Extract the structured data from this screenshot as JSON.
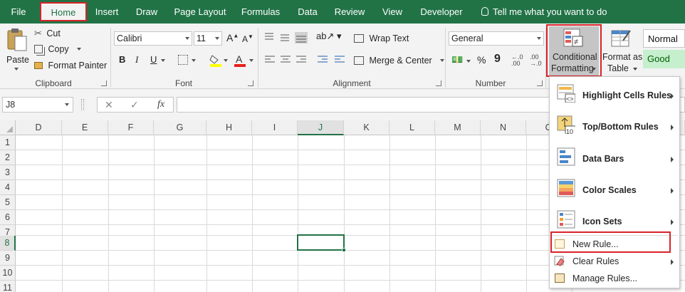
{
  "tabs": [
    "File",
    "Home",
    "Insert",
    "Draw",
    "Page Layout",
    "Formulas",
    "Data",
    "Review",
    "View",
    "Developer"
  ],
  "tell_me": "Tell me what you want to do",
  "clipboard": {
    "paste": "Paste",
    "cut": "Cut",
    "copy": "Copy",
    "format_painter": "Format Painter",
    "label": "Clipboard"
  },
  "font": {
    "name": "Calibri",
    "size": "11",
    "bold": "B",
    "italic": "I",
    "underline": "U",
    "label": "Font"
  },
  "alignment": {
    "wrap_text": "Wrap Text",
    "merge_center": "Merge & Center",
    "label": "Alignment"
  },
  "number": {
    "format": "General",
    "percent": "%",
    "comma": "9",
    "label": "Number"
  },
  "styles": {
    "conditional_formatting_line1": "Conditional",
    "conditional_formatting_line2": "Formatting",
    "format_as_table_line1": "Format as",
    "format_as_table_line2": "Table",
    "normal": "Normal",
    "good": "Good"
  },
  "formula_bar": {
    "name_box": "J8",
    "fx": "fx",
    "cancel": "✕",
    "enter": "✓"
  },
  "columns": [
    "D",
    "E",
    "F",
    "G",
    "H",
    "I",
    "J",
    "K",
    "L",
    "M",
    "N",
    "O"
  ],
  "rows": [
    "1",
    "2",
    "3",
    "4",
    "5",
    "6",
    "7",
    "8",
    "9",
    "10",
    "11"
  ],
  "menu": {
    "highlight_cells_rules": "Highlight Cells Rules",
    "top_bottom_rules": "Top/Bottom Rules",
    "data_bars": "Data Bars",
    "color_scales": "Color Scales",
    "icon_sets": "Icon Sets",
    "new_rule": "New Rule...",
    "clear_rules": "Clear Rules",
    "manage_rules": "Manage Rules..."
  },
  "colors": {
    "excel_green": "#217346",
    "highlight_red": "#d8232a",
    "good_fill": "#c6efce",
    "good_text": "#006100"
  }
}
